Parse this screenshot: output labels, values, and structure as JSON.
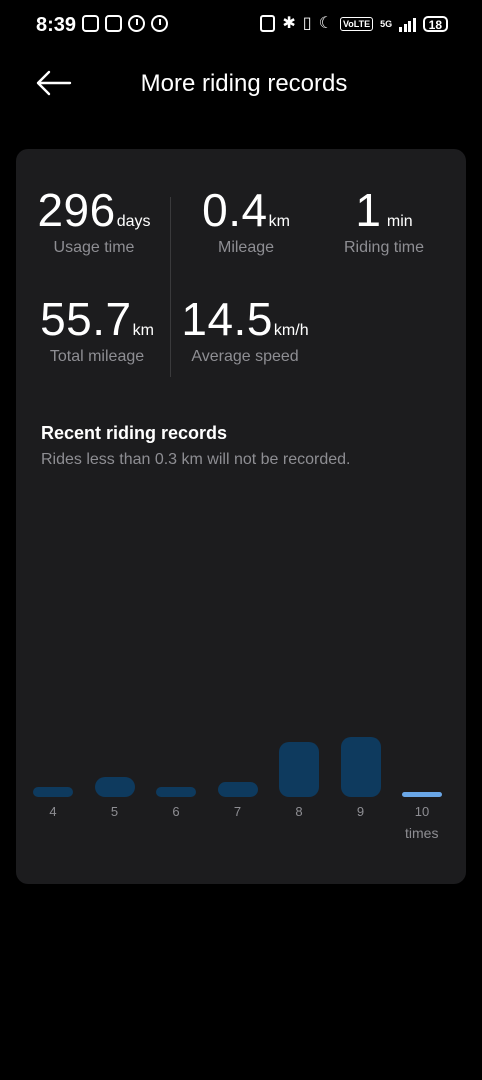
{
  "status_bar": {
    "time": "8:39",
    "battery": "18",
    "network": "5G",
    "volte": "VoLTE"
  },
  "header": {
    "title": "More riding records",
    "back_icon": "arrow-left-icon"
  },
  "stats": {
    "usage_time": {
      "value": "296",
      "unit": "days",
      "label": "Usage time"
    },
    "mileage": {
      "value": "0.4",
      "unit": "km",
      "label": "Mileage"
    },
    "riding_time": {
      "value": "1",
      "unit": "min",
      "label": "Riding time"
    },
    "total_mileage": {
      "value": "55.7",
      "unit": "km",
      "label": "Total mileage"
    },
    "average_speed": {
      "value": "14.5",
      "unit": "km/h",
      "label": "Average speed"
    }
  },
  "recent": {
    "title": "Recent riding records",
    "subtitle": "Rides less than 0.3 km will not be recorded."
  },
  "chart_data": {
    "type": "bar",
    "categories": [
      "4",
      "5",
      "6",
      "7",
      "8",
      "9",
      "10"
    ],
    "values": [
      1,
      2,
      1,
      1.5,
      5.5,
      6,
      0.5
    ],
    "highlighted_category": "10",
    "xlabel": "times",
    "ylabel": "",
    "bar_color": "#0e3a5e",
    "highlight_color": "#6aa7e8"
  },
  "colors": {
    "background": "#000000",
    "card": "#1c1c1e",
    "secondary_text": "#8e8e93"
  }
}
